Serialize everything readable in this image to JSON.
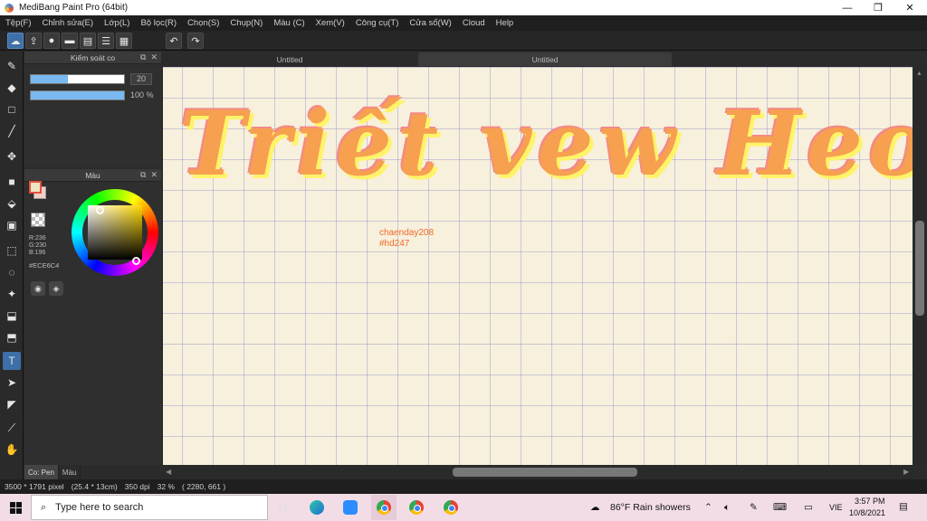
{
  "window": {
    "title": "MediBang Paint Pro (64bit)"
  },
  "menu": [
    "Tệp(F)",
    "Chỉnh sửa(E)",
    "Lớp(L)",
    "Bộ lọc(R)",
    "Chọn(S)",
    "Chụp(N)",
    "Màu (C)",
    "Xem(V)",
    "Công cụ(T)",
    "Cửa sổ(W)",
    "Cloud",
    "Help"
  ],
  "toolbar": {
    "icons": [
      "cloud-icon",
      "share-icon",
      "chat-icon",
      "comment-icon",
      "page-icon",
      "list-icon",
      "grid-icon"
    ],
    "undo_icon": "undo-icon",
    "redo_icon": "redo-icon"
  },
  "tools": [
    "brush",
    "eraser",
    "rectangle",
    "pen",
    "move",
    "fill-rect",
    "bucket",
    "gradient",
    "select-rect",
    "lasso",
    "magic-wand",
    "select-pen",
    "select-eraser",
    "text",
    "operation",
    "divide",
    "eyedropper",
    "hand"
  ],
  "brush_panel": {
    "title": "Kiểm soát co",
    "size": 20,
    "size_fraction": 0.4,
    "opacity_label": "100 %",
    "opacity_fraction": 1.0
  },
  "color_panel": {
    "title": "Màu",
    "r": "R:236",
    "g": "G:230",
    "b": "B:196",
    "hex": "#ECE6C4",
    "primary_color": "#ECE6C4"
  },
  "bottom_tabs": [
    "Co: Pen",
    "Màu"
  ],
  "doc_tabs": [
    "Untitled",
    "Untitled"
  ],
  "canvas": {
    "lettering": "Triết vew Heo",
    "signature_line1": "chaenday208",
    "signature_line2": "#hd247"
  },
  "status": {
    "size": "3500 * 1791 pixel",
    "physical": "(25.4 * 13cm)",
    "dpi": "350 dpi",
    "zoom": "32 %",
    "coords": "( 2280, 661 )"
  },
  "taskbar": {
    "search_placeholder": "Type here to search",
    "weather": "86°F  Rain showers",
    "lang": "VIE",
    "time": "3:57 PM",
    "date": "10/8/2021"
  }
}
